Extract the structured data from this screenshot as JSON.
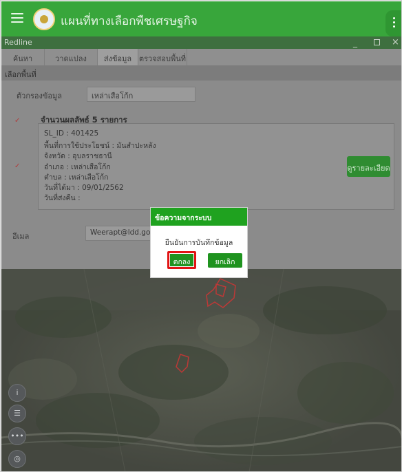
{
  "app": {
    "title": "แผนที่ทางเลือกพืชเศรษฐกิจ"
  },
  "panel": {
    "title": "Redline",
    "window_buttons": {
      "minimize": "_",
      "close": "×"
    },
    "tabs": [
      {
        "label": "ค้นหา"
      },
      {
        "label": "วาดแปลง"
      },
      {
        "label": "ส่งข้อมูล"
      },
      {
        "label": "ตรวจสอบพื้นที่"
      }
    ],
    "section_title": "เลือกพื้นที่",
    "filter": {
      "label": "ตัวกรองข้อมูล",
      "value": "เหล่าเสือโก้ก"
    },
    "result_count": "จำนวนผลลัพธ์ 5 รายการ",
    "result": {
      "sl_id": "SL_ID : 401425",
      "land_use": "พื้นที่การใช้ประโยชน์ : มันสำปะหลัง",
      "province": "จังหวัด : อุบลราชธานี",
      "district": "อำเภอ : เหล่าเสือโก้ก",
      "subdistrict": "ตำบล : เหล่าเสือโก้ก",
      "date_got": "วันที่ได้มา : 09/01/2562",
      "date_sent": "วันที่ส่งคืน :",
      "detail_button": "ดูรายละเอียด"
    },
    "email": {
      "label": "อีเมล",
      "value": "Weerapt@ldd.go.th"
    }
  },
  "map_controls": [
    {
      "icon": "info-icon",
      "glyph": "i"
    },
    {
      "icon": "layers-icon",
      "glyph": "☰"
    },
    {
      "icon": "more-icon",
      "glyph": "•••"
    },
    {
      "icon": "locate-icon",
      "glyph": "◎"
    }
  ],
  "dialog": {
    "title": "ข้อความจากระบบ",
    "message": "ยืนยันการบันทึกข้อมูล",
    "ok_label": "ตกลง",
    "cancel_label": "ยกเลิก"
  },
  "colors": {
    "app_bar": "#38a63b",
    "dialog_header": "#1fa21f",
    "button_green": "#1f931f",
    "highlight_red": "#e11414",
    "plot_outline_red": "#d03535"
  }
}
